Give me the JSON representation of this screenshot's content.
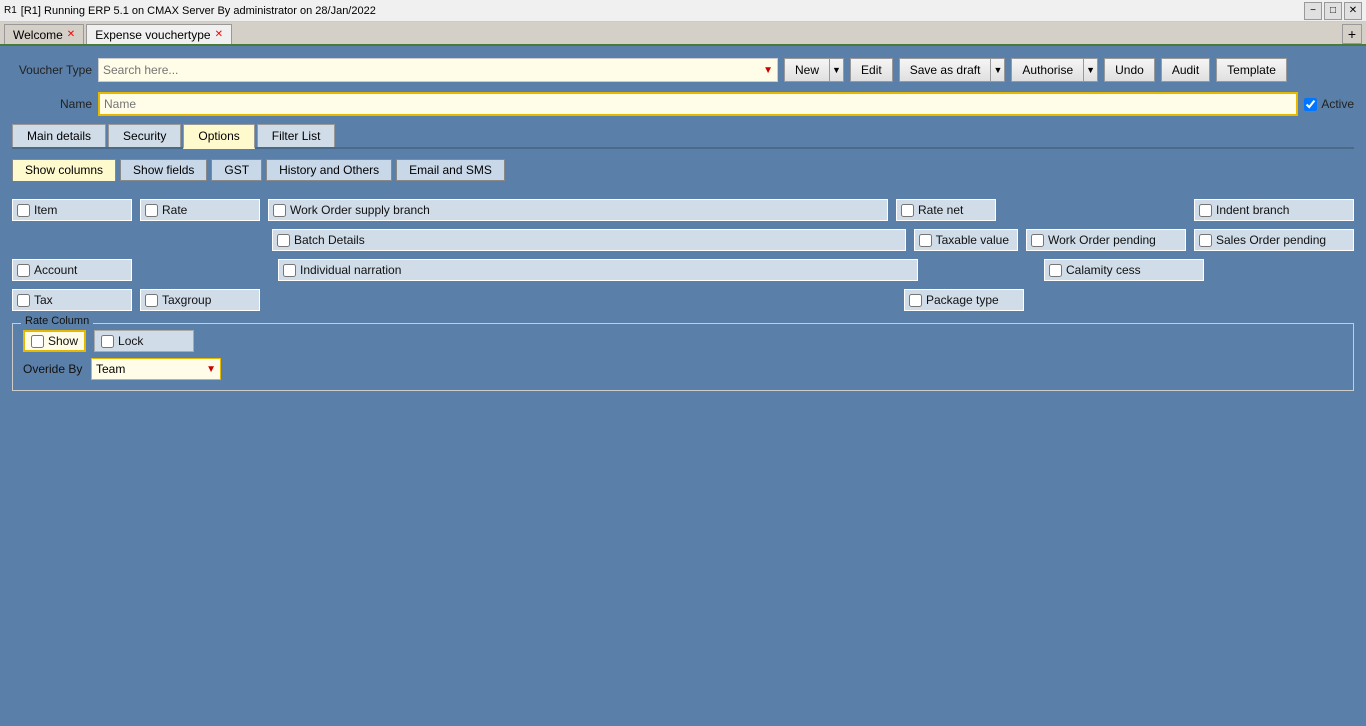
{
  "titleBar": {
    "icon": "R1",
    "title": "[R1] Running ERP 5.1 on CMAX Server By administrator on 28/Jan/2022",
    "minimize": "−",
    "maximize": "□",
    "close": "✕"
  },
  "tabs": [
    {
      "label": "Welcome",
      "active": false,
      "closable": true
    },
    {
      "label": "Expense vouchertype",
      "active": true,
      "closable": true
    }
  ],
  "tabAdd": "+",
  "toolbar": {
    "voucherTypeLabel": "Voucher Type",
    "searchPlaceholder": "Search here...",
    "newLabel": "New",
    "editLabel": "Edit",
    "saveAsDraftLabel": "Save as draft",
    "authoriseLabel": "Authorise",
    "undoLabel": "Undo",
    "auditLabel": "Audit",
    "templateLabel": "Template"
  },
  "nameRow": {
    "label": "Name",
    "placeholder": "Name",
    "activeLabel": "Active",
    "activeChecked": true
  },
  "navTabs": [
    {
      "label": "Main details",
      "active": false
    },
    {
      "label": "Security",
      "active": false
    },
    {
      "label": "Options",
      "active": true
    },
    {
      "label": "Filter List",
      "active": false
    }
  ],
  "subTabs": [
    {
      "label": "Show columns",
      "active": true
    },
    {
      "label": "Show fields",
      "active": false
    },
    {
      "label": "GST",
      "active": false
    },
    {
      "label": "History and Others",
      "active": false
    },
    {
      "label": "Email and SMS",
      "active": false
    }
  ],
  "checkboxes": {
    "row1": [
      {
        "label": "Item",
        "checked": false,
        "id": "cb-item"
      },
      {
        "label": "Rate",
        "checked": false,
        "id": "cb-rate"
      },
      {
        "label": "Work Order supply branch",
        "checked": false,
        "id": "cb-work-order-supply",
        "wide": true
      },
      {
        "label": "Rate net",
        "checked": false,
        "id": "cb-rate-net"
      },
      {
        "label": "Indent branch",
        "checked": false,
        "id": "cb-indent-branch"
      }
    ],
    "row2": [
      {
        "label": "Batch Details",
        "checked": false,
        "id": "cb-batch",
        "wide": true
      },
      {
        "label": "Taxable value",
        "checked": false,
        "id": "cb-taxable"
      },
      {
        "label": "Work Order pending",
        "checked": false,
        "id": "cb-work-order-pending"
      },
      {
        "label": "Sales Order pending",
        "checked": false,
        "id": "cb-sales-order"
      }
    ],
    "row3": [
      {
        "label": "Account",
        "checked": false,
        "id": "cb-account"
      },
      {
        "label": "Individual narration",
        "checked": false,
        "id": "cb-individual",
        "wide": true
      },
      {
        "label": "Calamity cess",
        "checked": false,
        "id": "cb-calamity"
      }
    ],
    "row4": [
      {
        "label": "Tax",
        "checked": false,
        "id": "cb-tax"
      },
      {
        "label": "Taxgroup",
        "checked": false,
        "id": "cb-taxgroup"
      },
      {
        "label": "Package type",
        "checked": false,
        "id": "cb-package"
      }
    ]
  },
  "rateColumn": {
    "legend": "Rate Column",
    "showLabel": "Show",
    "showChecked": false,
    "lockLabel": "Lock",
    "lockChecked": false,
    "overrideByLabel": "Overide By",
    "overrideByValue": "Team"
  }
}
